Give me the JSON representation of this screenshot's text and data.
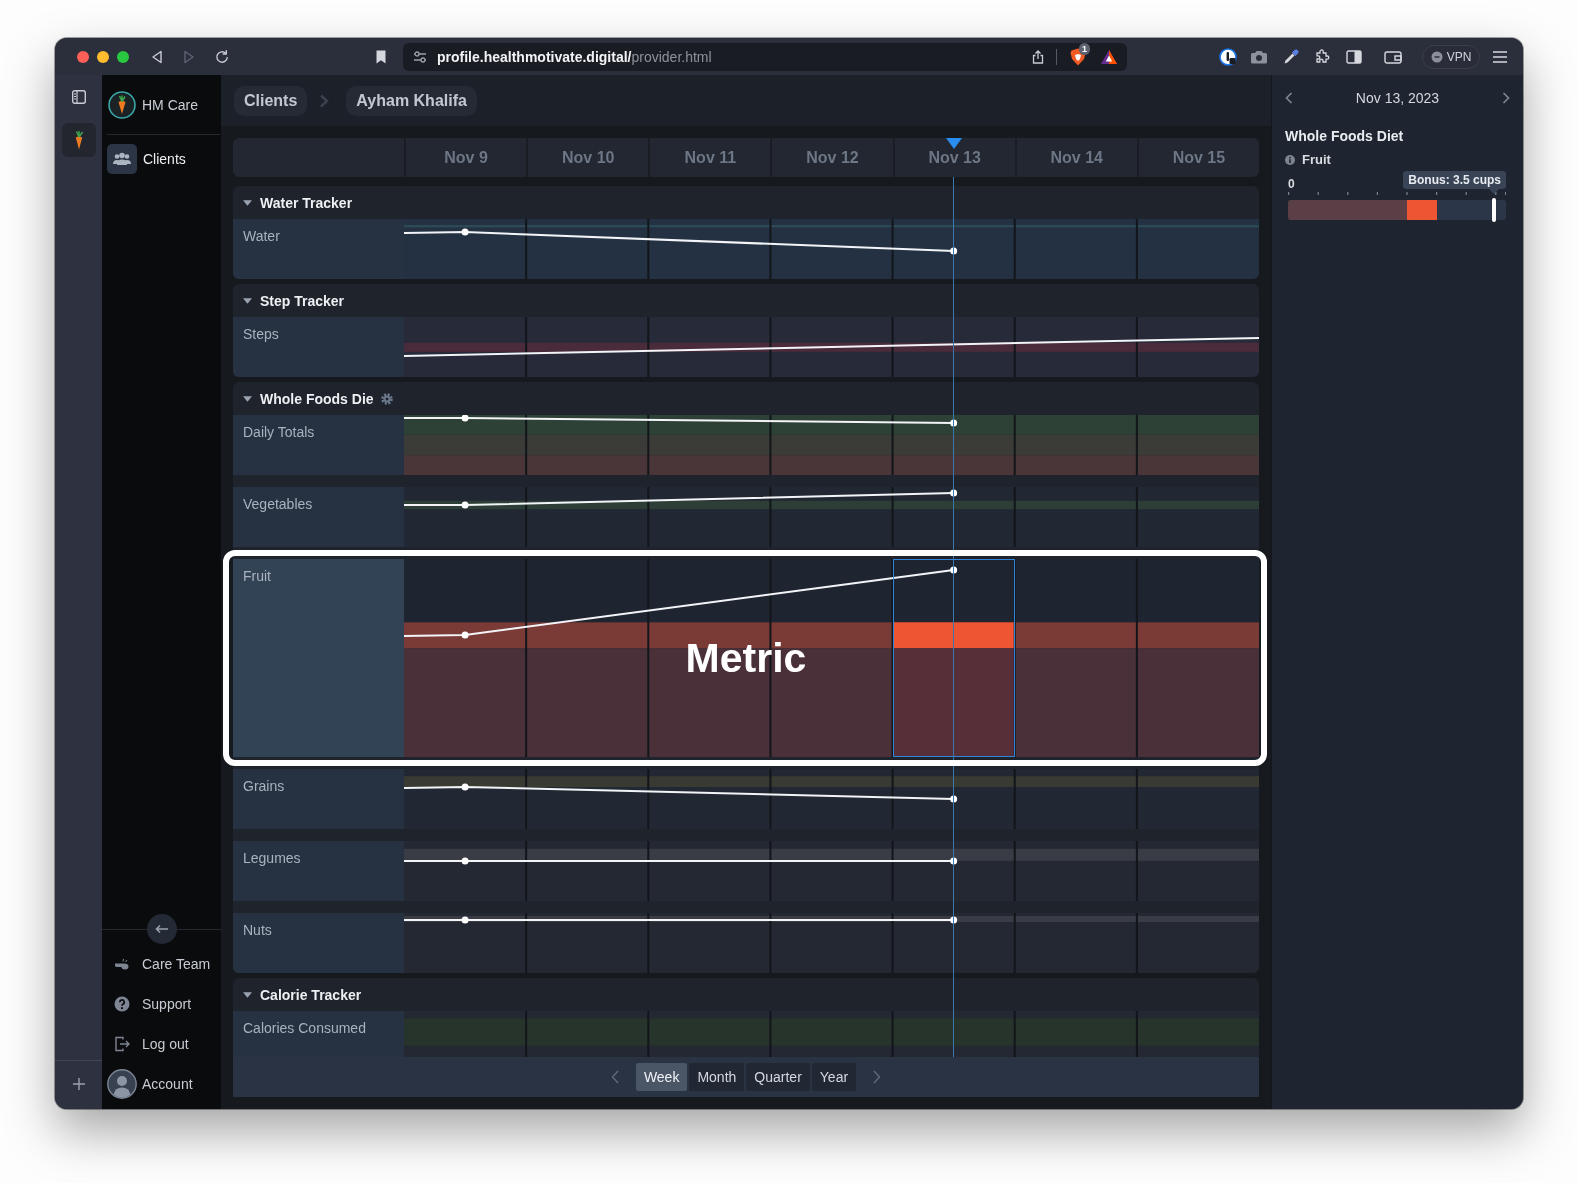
{
  "browser": {
    "url_host": "profile.healthmotivate.digital/",
    "url_path": "provider.html",
    "shields_count": "1",
    "vpn": {
      "label": "VPN",
      "on": false
    }
  },
  "sidebar": {
    "brand": "HM Care",
    "nav": [
      {
        "label": "Clients",
        "selected": true
      }
    ],
    "footer": [
      {
        "kind": "team",
        "label": "Care Team"
      },
      {
        "kind": "support",
        "label": "Support"
      },
      {
        "kind": "logout",
        "label": "Log out"
      },
      {
        "kind": "account",
        "label": "Account"
      }
    ]
  },
  "breadcrumb": [
    "Clients",
    "Ayham Khalifa"
  ],
  "timeline": {
    "days": [
      {
        "label": "Nov 9",
        "selected": false
      },
      {
        "label": "Nov 10",
        "selected": false
      },
      {
        "label": "Nov 11",
        "selected": false
      },
      {
        "label": "Nov 12",
        "selected": false
      },
      {
        "label": "Nov 13",
        "selected": true
      },
      {
        "label": "Nov 14",
        "selected": false
      },
      {
        "label": "Nov 15",
        "selected": false
      }
    ],
    "groups": [
      {
        "title": "Water Tracker",
        "expanded": true,
        "settings": false,
        "rows": [
          {
            "label": "Water",
            "selected": false
          }
        ]
      },
      {
        "title": "Step Tracker",
        "expanded": true,
        "settings": false,
        "rows": [
          {
            "label": "Steps",
            "selected": false
          }
        ]
      },
      {
        "title": "Whole Foods Die",
        "expanded": true,
        "settings": true,
        "rows": [
          {
            "label": "Daily Totals",
            "selected": false
          },
          {
            "label": "Vegetables",
            "selected": false
          },
          {
            "label": "Fruit",
            "selected": true,
            "callout": "Metric"
          },
          {
            "label": "Grains",
            "selected": false
          },
          {
            "label": "Legumes",
            "selected": false
          },
          {
            "label": "Nuts",
            "selected": false
          }
        ]
      },
      {
        "title": "Calorie Tracker",
        "expanded": true,
        "settings": false,
        "rows": [
          {
            "label": "Calories Consumed",
            "selected": false
          }
        ]
      }
    ]
  },
  "range_buttons": [
    {
      "label": "Week",
      "selected": true
    },
    {
      "label": "Month",
      "selected": false
    },
    {
      "label": "Quarter",
      "selected": false
    },
    {
      "label": "Year",
      "selected": false
    }
  ],
  "detail": {
    "date": "Nov 13, 2023",
    "title": "Whole Foods Diet",
    "metric": "Fruit",
    "scale_min": "0",
    "tooltip": "Bonus: 3.5 cups",
    "level": 0.945
  }
}
